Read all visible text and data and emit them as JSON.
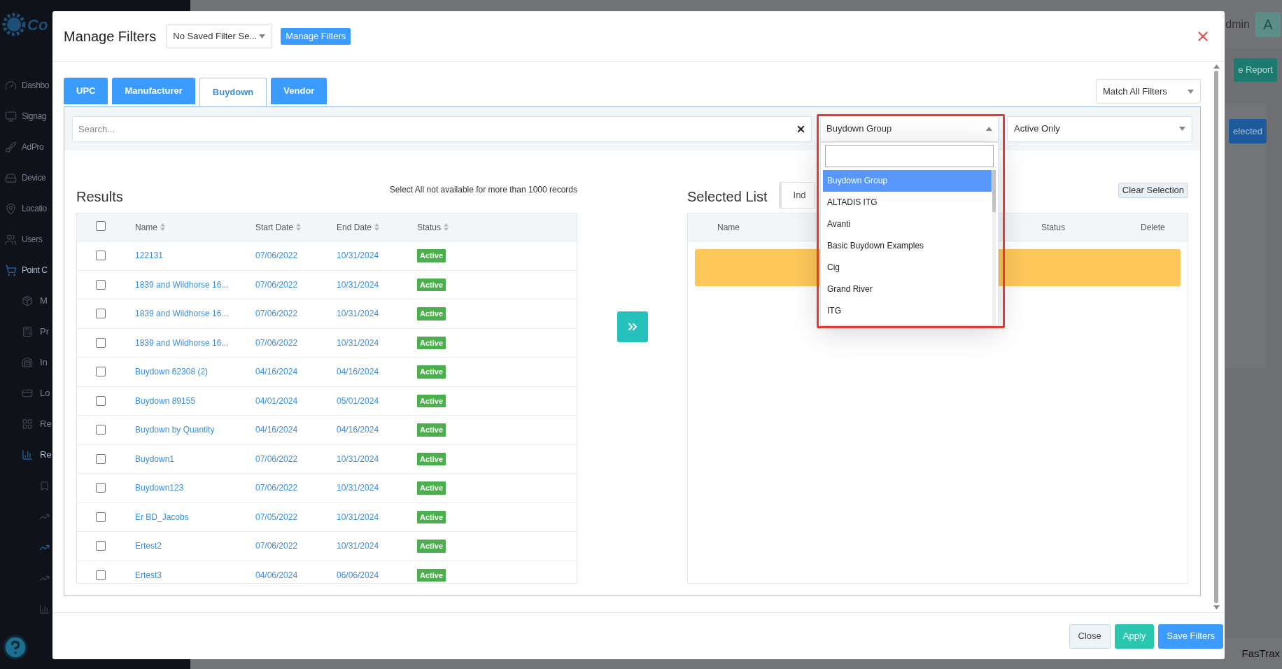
{
  "background": {
    "logo_text": "Co",
    "sidebar": [
      {
        "label": "Dashbo",
        "selected": false
      },
      {
        "label": "Signag",
        "selected": false
      },
      {
        "label": "AdPro",
        "selected": false
      },
      {
        "label": "Device",
        "selected": false
      },
      {
        "label": "Locatio",
        "selected": false
      },
      {
        "label": "Users",
        "selected": false
      },
      {
        "label": "Point C",
        "selected": true,
        "children": [
          {
            "label": "M",
            "selected": false
          },
          {
            "label": "Pr",
            "selected": false
          },
          {
            "label": "In",
            "selected": false
          },
          {
            "label": "Lo",
            "selected": false
          },
          {
            "label": "Re",
            "selected": false
          },
          {
            "label": "Re",
            "selected": true
          }
        ]
      }
    ],
    "user_name": "dmin",
    "avatar": "A",
    "report_button": "e Report",
    "selected_button": "elected",
    "footer": "FasTrax"
  },
  "modal": {
    "title": "Manage Filters",
    "saved_filter": "No Saved Filter Se...",
    "manage_button": "Manage Filters",
    "tabs": [
      {
        "label": "UPC",
        "selected": false
      },
      {
        "label": "Manufacturer",
        "selected": false
      },
      {
        "label": "Buydown",
        "selected": true
      },
      {
        "label": "Vendor",
        "selected": false
      }
    ],
    "match_select": "Match All Filters",
    "search": {
      "placeholder": "Search..."
    },
    "group_select": {
      "value": "Buydown Group",
      "expanded": true,
      "options": [
        {
          "label": "Buydown Group",
          "selected": true
        },
        {
          "label": "ALTADIS ITG",
          "selected": false
        },
        {
          "label": "Avanti",
          "selected": false
        },
        {
          "label": "Basic Buydown Examples",
          "selected": false
        },
        {
          "label": "Cig",
          "selected": false
        },
        {
          "label": "Grand River",
          "selected": false
        },
        {
          "label": "ITG",
          "selected": false
        }
      ]
    },
    "status_select": "Active Only",
    "results": {
      "title": "Results",
      "note": "Select All not available for more than 1000 records",
      "select_all": false,
      "columns": [
        "Name",
        "Start Date",
        "End Date",
        "Status"
      ],
      "rows": [
        {
          "checked": false,
          "name": "122131",
          "start": "07/06/2022",
          "end": "10/31/2024",
          "status": "Active"
        },
        {
          "checked": false,
          "name": "1839 and Wildhorse 16...",
          "start": "07/06/2022",
          "end": "10/31/2024",
          "status": "Active"
        },
        {
          "checked": false,
          "name": "1839 and Wildhorse 16...",
          "start": "07/06/2022",
          "end": "10/31/2024",
          "status": "Active"
        },
        {
          "checked": false,
          "name": "1839 and Wildhorse 16...",
          "start": "07/06/2022",
          "end": "10/31/2024",
          "status": "Active"
        },
        {
          "checked": false,
          "name": "Buydown 62308 (2)",
          "start": "04/16/2024",
          "end": "04/16/2024",
          "status": "Active"
        },
        {
          "checked": false,
          "name": "Buydown 89155",
          "start": "04/01/2024",
          "end": "05/01/2024",
          "status": "Active"
        },
        {
          "checked": false,
          "name": "Buydown by Quantity",
          "start": "04/16/2024",
          "end": "04/16/2024",
          "status": "Active"
        },
        {
          "checked": false,
          "name": "Buydown1",
          "start": "07/06/2022",
          "end": "10/31/2024",
          "status": "Active"
        },
        {
          "checked": false,
          "name": "Buydown123",
          "start": "07/06/2022",
          "end": "10/31/2024",
          "status": "Active"
        },
        {
          "checked": false,
          "name": "Er BD_Jacobs",
          "start": "07/05/2022",
          "end": "10/31/2024",
          "status": "Active"
        },
        {
          "checked": false,
          "name": "Ertest2",
          "start": "07/06/2022",
          "end": "10/31/2024",
          "status": "Active"
        },
        {
          "checked": false,
          "name": "Ertest3",
          "start": "04/06/2024",
          "end": "06/06/2024",
          "status": "Active"
        }
      ]
    },
    "selected_list": {
      "title": "Selected List",
      "toggle": "Ind",
      "clear_button": "Clear Selection",
      "columns": [
        "Name",
        "Status",
        "Delete"
      ]
    },
    "footer_buttons": [
      {
        "label": "Close",
        "kind": "secondary"
      },
      {
        "label": "Apply",
        "kind": "success"
      },
      {
        "label": "Save Filters",
        "kind": "primary"
      }
    ]
  }
}
